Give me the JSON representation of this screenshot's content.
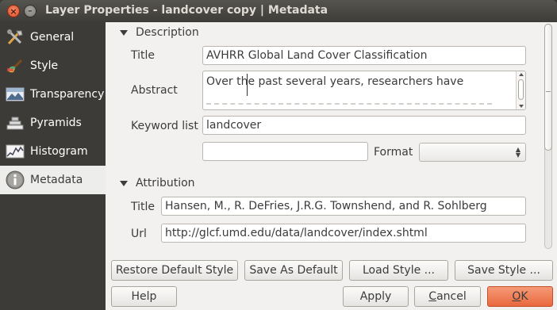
{
  "window": {
    "title": "Layer Properties - landcover copy | Metadata",
    "close_glyph": "×",
    "min_glyph": "–"
  },
  "sidebar": {
    "items": [
      {
        "label": "General",
        "icon": "tools-icon"
      },
      {
        "label": "Style",
        "icon": "paintbrush-icon"
      },
      {
        "label": "Transparency",
        "icon": "transparency-icon"
      },
      {
        "label": "Pyramids",
        "icon": "pyramid-icon"
      },
      {
        "label": "Histogram",
        "icon": "histogram-icon"
      },
      {
        "label": "Metadata",
        "icon": "info-icon"
      }
    ],
    "active": "Metadata"
  },
  "description": {
    "header": "Description",
    "title_label": "Title",
    "title_value": "AVHRR Global Land Cover Classification",
    "abstract_label": "Abstract",
    "abstract_value": "Over the past several years, researchers have",
    "keyword_label": "Keyword list",
    "keyword_value": "landcover",
    "extra_value": "",
    "format_label": "Format",
    "format_value": ""
  },
  "attribution": {
    "header": "Attribution",
    "title_label": "Title",
    "title_value": "Hansen, M., R. DeFries, J.R.G. Townshend, and R. Sohlberg",
    "url_label": "Url",
    "url_value": "http://glcf.umd.edu/data/landcover/index.shtml"
  },
  "style_buttons": {
    "restore": "Restore Default Style",
    "save_default": "Save As Default",
    "load": "Load Style ...",
    "save": "Save Style ..."
  },
  "dialog_buttons": {
    "help": "Help",
    "apply": "Apply",
    "cancel_u": "C",
    "cancel_rest": "ancel",
    "ok_u": "O",
    "ok_rest": "K"
  },
  "colors": {
    "sidebar_bg": "#3c3b37",
    "accent_ok": "#e8683e",
    "active_bg": "#ededec"
  }
}
